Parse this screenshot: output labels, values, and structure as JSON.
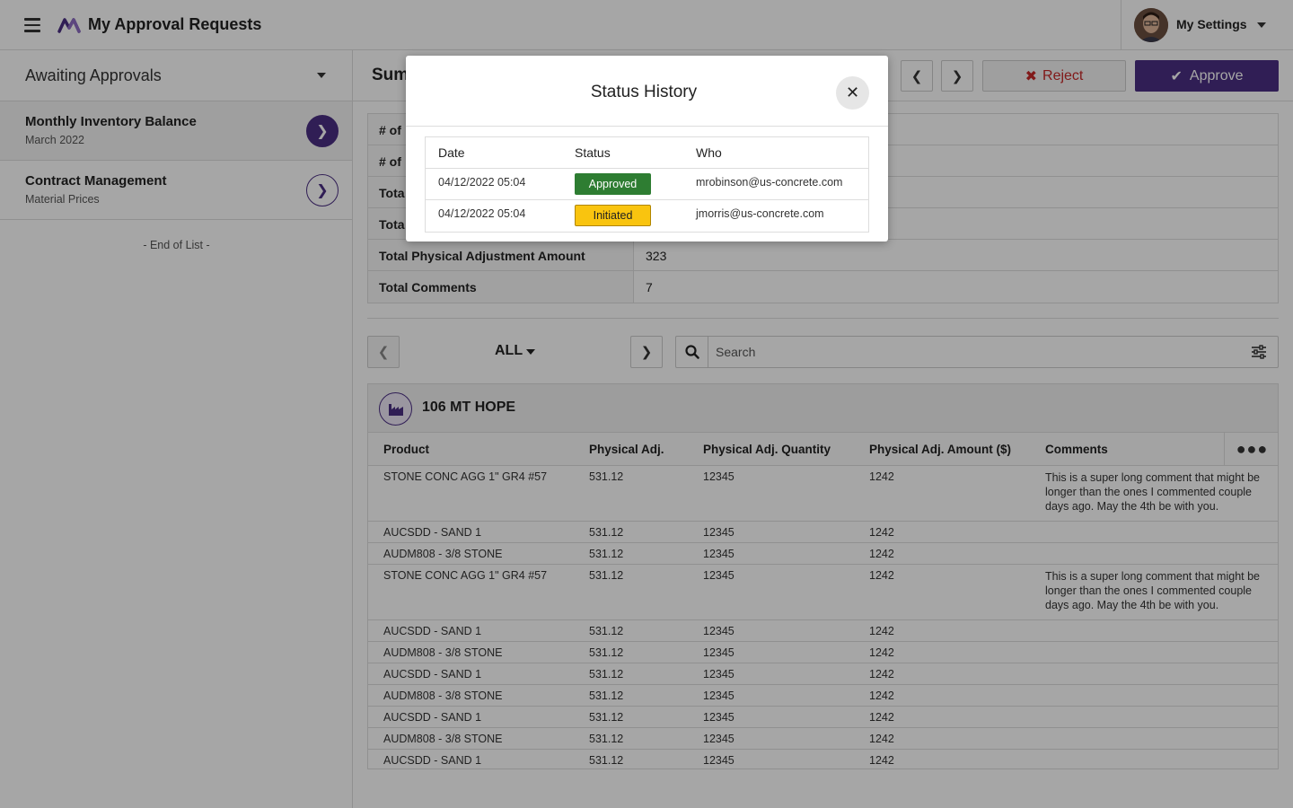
{
  "header": {
    "app_title": "My Approval Requests",
    "settings_label": "My Settings"
  },
  "sidebar": {
    "filter_label": "Awaiting Approvals",
    "items": [
      {
        "title": "Monthly Inventory Balance",
        "subtitle": "March 2022"
      },
      {
        "title": "Contract Management",
        "subtitle": "Material Prices"
      }
    ],
    "end_label": "- End of List -"
  },
  "main": {
    "title": "Sum",
    "reject_label": "Reject",
    "approve_label": "Approve",
    "summary": [
      {
        "key": "# of",
        "value": ""
      },
      {
        "key": "# of",
        "value": ""
      },
      {
        "key": "Tota",
        "value": ""
      },
      {
        "key": "Tota",
        "value": ""
      },
      {
        "key": "Total Physical Adjustment Amount",
        "value": "323"
      },
      {
        "key": "Total Comments",
        "value": "7"
      }
    ],
    "filter": {
      "label": "ALL",
      "search_placeholder": "Search"
    },
    "plant": {
      "name": "106 MT HOPE",
      "columns": [
        "Product",
        "Physical Adj.",
        "Physical Adj. Quantity",
        "Physical Adj. Amount ($)",
        "Comments"
      ],
      "rows": [
        {
          "product": "STONE CONC AGG 1\" GR4 #57",
          "adj": "531.12",
          "qty": "12345",
          "amount": "1242",
          "comment": "This is a super long comment that might be longer than the ones I commented couple days ago. May the 4th be with you."
        },
        {
          "product": "AUCSDD - SAND 1",
          "adj": "531.12",
          "qty": "12345",
          "amount": "1242",
          "comment": ""
        },
        {
          "product": "AUDM808 - 3/8 STONE",
          "adj": "531.12",
          "qty": "12345",
          "amount": "1242",
          "comment": ""
        },
        {
          "product": "STONE CONC AGG 1\" GR4 #57",
          "adj": "531.12",
          "qty": "12345",
          "amount": "1242",
          "comment": "This is a super long comment that might be longer than the ones I commented couple days ago. May the 4th be with you."
        },
        {
          "product": "AUCSDD - SAND 1",
          "adj": "531.12",
          "qty": "12345",
          "amount": "1242",
          "comment": ""
        },
        {
          "product": "AUDM808 - 3/8 STONE",
          "adj": "531.12",
          "qty": "12345",
          "amount": "1242",
          "comment": ""
        },
        {
          "product": "AUCSDD - SAND 1",
          "adj": "531.12",
          "qty": "12345",
          "amount": "1242",
          "comment": ""
        },
        {
          "product": "AUDM808 - 3/8 STONE",
          "adj": "531.12",
          "qty": "12345",
          "amount": "1242",
          "comment": ""
        },
        {
          "product": "AUCSDD - SAND 1",
          "adj": "531.12",
          "qty": "12345",
          "amount": "1242",
          "comment": ""
        },
        {
          "product": "AUDM808 - 3/8 STONE",
          "adj": "531.12",
          "qty": "12345",
          "amount": "1242",
          "comment": ""
        },
        {
          "product": "AUCSDD - SAND 1",
          "adj": "531.12",
          "qty": "12345",
          "amount": "1242",
          "comment": ""
        }
      ]
    }
  },
  "modal": {
    "title": "Status History",
    "columns": [
      "Date",
      "Status",
      "Who"
    ],
    "rows": [
      {
        "date": "04/12/2022 05:04",
        "status": "Approved",
        "who": "mrobinson@us-concrete.com"
      },
      {
        "date": "04/12/2022 05:04",
        "status": "Initiated",
        "who": "jmorris@us-concrete.com"
      }
    ]
  },
  "colors": {
    "brand": "#4b2e83",
    "reject": "#c62828",
    "approved": "#2e7d32",
    "initiated": "#f9c40f"
  }
}
